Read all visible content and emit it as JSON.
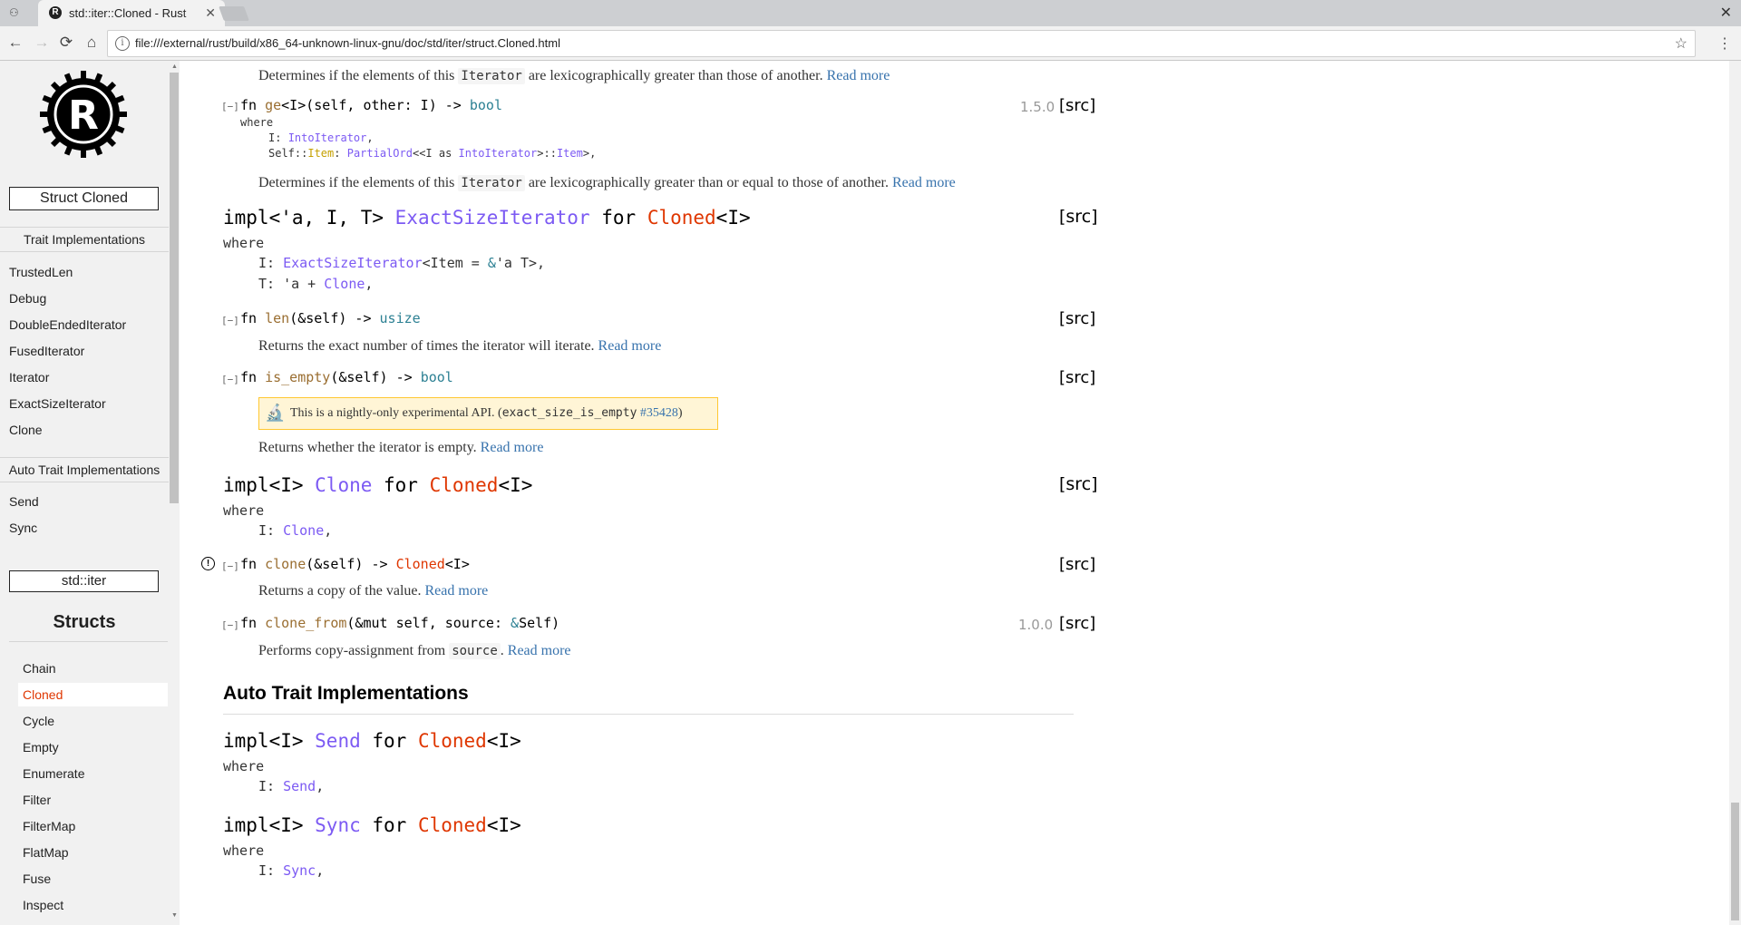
{
  "browser": {
    "tab_title": "std::iter::Cloned - Rust",
    "url": "file:///external/rust/build/x86_64-unknown-linux-gnu/doc/std/iter/struct.Cloned.html"
  },
  "sidebar": {
    "struct_box": "Struct Cloned",
    "trait_impls_heading": "Trait Implementations",
    "trait_impls": [
      "TrustedLen",
      "Debug",
      "DoubleEndedIterator",
      "FusedIterator",
      "Iterator",
      "ExactSizeIterator",
      "Clone"
    ],
    "auto_trait_heading": "Auto Trait Implementations",
    "auto_traits": [
      "Send",
      "Sync"
    ],
    "module_box": "std::iter",
    "structs_heading": "Structs",
    "structs": [
      "Chain",
      "Cloned",
      "Cycle",
      "Empty",
      "Enumerate",
      "Filter",
      "FilterMap",
      "FlatMap",
      "Fuse",
      "Inspect"
    ]
  },
  "main": {
    "gt_doc": "Determines if the elements of this",
    "gt_code": "Iterator",
    "gt_doc_tail": "are lexicographically greater than those of another.",
    "read_more": "Read more",
    "ge": {
      "toggle": "[−]",
      "fn": "fn ",
      "name": "ge",
      "sig": "<I>(self, other: I) -> ",
      "ret": "bool",
      "version": "1.5.0",
      "src": "[src]",
      "where": "where",
      "w1a": "I: ",
      "w1b": "IntoIterator",
      "w1c": ",",
      "w2a": "Self::",
      "w2b": "Item",
      "w2c": ": ",
      "w2d": "PartialOrd",
      "w2e": "<<I as ",
      "w2f": "IntoIterator",
      "w2g": ">::",
      "w2h": "Item",
      "w2i": ">,",
      "doc": "Determines if the elements of this",
      "doc_code": "Iterator",
      "doc_tail": "are lexicographically greater than or equal to those of another."
    },
    "impl_exact": {
      "a": "impl<'a, I, T> ",
      "trait": "ExactSizeIterator",
      "for": " for ",
      "struct": "Cloned",
      "gen": "<I>",
      "src": "[src]",
      "where": "where",
      "w1a": "I: ",
      "w1b": "ExactSizeIterator",
      "w1c": "<Item = ",
      "w1d": "&",
      "w1e": "'a T>,",
      "w2a": "T: 'a + ",
      "w2b": "Clone",
      "w2c": ","
    },
    "len": {
      "toggle": "[−]",
      "fn": "fn ",
      "name": "len",
      "sig": "(&self) -> ",
      "ret": "usize",
      "src": "[src]",
      "doc": "Returns the exact number of times the iterator will iterate."
    },
    "is_empty": {
      "toggle": "[−]",
      "fn": "fn ",
      "name": "is_empty",
      "sig": "(&self) -> ",
      "ret": "bool",
      "src": "[src]",
      "unstable_pre": "This is a nightly-only experimental API. (",
      "unstable_code": "exact_size_is_empty",
      "unstable_link": "#35428",
      "unstable_post": ")",
      "doc": "Returns whether the iterator is empty."
    },
    "impl_clone": {
      "a": "impl<I> ",
      "trait": "Clone",
      "for": " for ",
      "struct": "Cloned",
      "gen": "<I>",
      "src": "[src]",
      "where": "where",
      "w1a": "I: ",
      "w1b": "Clone",
      "w1c": ","
    },
    "clone": {
      "toggle": "[−]",
      "fn": "fn ",
      "name": "clone",
      "sig": "(&self) -> ",
      "ret": "Cloned",
      "ret2": "<I>",
      "src": "[src]",
      "doc": "Returns a copy of the value."
    },
    "clone_from": {
      "toggle": "[−]",
      "fn": "fn ",
      "name": "clone_from",
      "sig": "(&mut self, source: ",
      "amp": "&",
      "sig2": "Self)",
      "version": "1.0.0",
      "src": "[src]",
      "doc": "Performs copy-assignment from",
      "doc_code": "source",
      "doc_tail": "."
    },
    "auto_heading": "Auto Trait Implementations",
    "impl_send": {
      "a": "impl<I> ",
      "trait": "Send",
      "for": " for ",
      "struct": "Cloned",
      "gen": "<I>",
      "where": "where",
      "w1a": "I: ",
      "w1b": "Send",
      "w1c": ","
    },
    "impl_sync": {
      "a": "impl<I> ",
      "trait": "Sync",
      "for": " for ",
      "struct": "Cloned",
      "gen": "<I>",
      "where": "where",
      "w1a": "I: ",
      "w1b": "Sync",
      "w1c": ","
    }
  }
}
